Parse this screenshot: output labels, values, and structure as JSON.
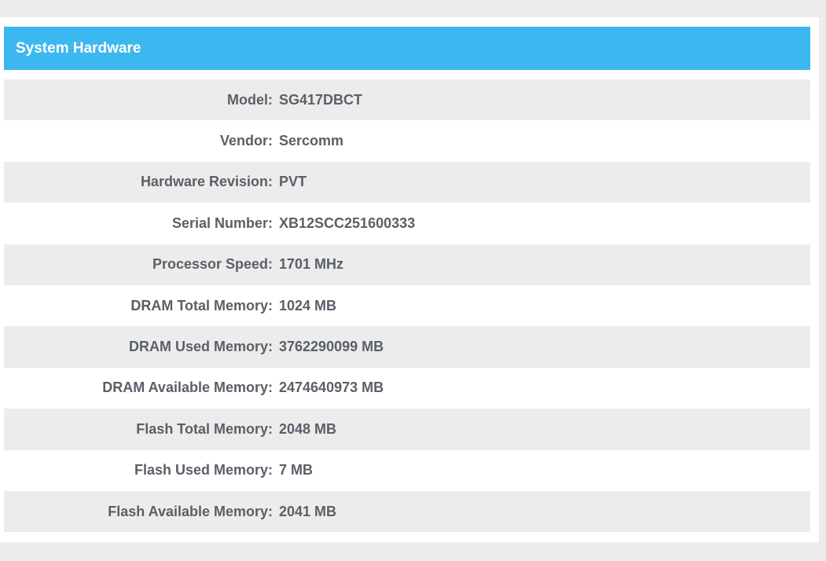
{
  "section": {
    "title": "System Hardware"
  },
  "rows": [
    {
      "label": "Model:",
      "value": "SG417DBCT"
    },
    {
      "label": "Vendor:",
      "value": "Sercomm"
    },
    {
      "label": "Hardware Revision:",
      "value": "PVT"
    },
    {
      "label": "Serial Number:",
      "value": "XB12SCC251600333"
    },
    {
      "label": "Processor Speed:",
      "value": "1701 MHz"
    },
    {
      "label": "DRAM Total Memory:",
      "value": "1024 MB"
    },
    {
      "label": "DRAM Used Memory:",
      "value": "3762290099 MB"
    },
    {
      "label": "DRAM Available Memory:",
      "value": "2474640973 MB"
    },
    {
      "label": "Flash Total Memory:",
      "value": "2048 MB"
    },
    {
      "label": "Flash Used Memory:",
      "value": "7 MB"
    },
    {
      "label": "Flash Available Memory:",
      "value": "2041 MB"
    }
  ],
  "colors": {
    "header_bg": "#3cb8f0",
    "header_text": "#ffffff",
    "row_shade": "#ececec",
    "text": "#5a6068",
    "page_bg": "#ececec"
  }
}
